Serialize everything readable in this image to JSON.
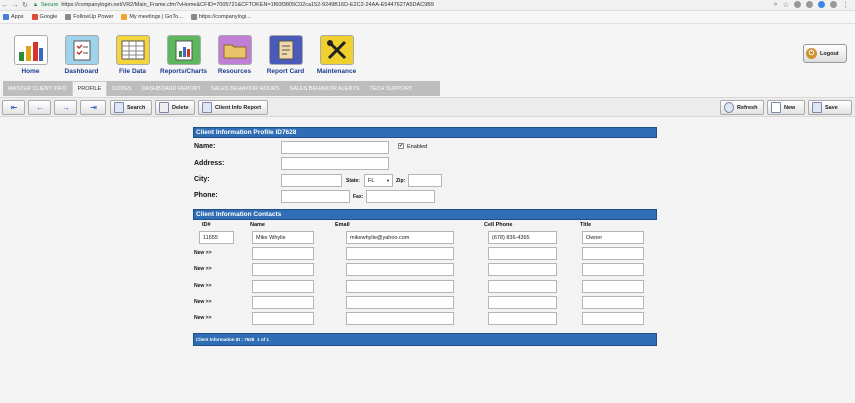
{
  "browser": {
    "secure_label": "Secure",
    "url": "https://companylogin.net/VR2/Main_Frame.cfm?vHome&CFID=7005721&CFTOKEN=1f60f3805C02ca152-9249B16D-E2C2-24AA-E5447627A5DAC9B9",
    "bookmarks": [
      "Apps",
      "Google",
      "FollowUp Power",
      "My meetings | GoTo...",
      "https://companylogi..."
    ]
  },
  "nav": {
    "items": [
      {
        "label": "Home",
        "icon": "bar-chart-icon"
      },
      {
        "label": "Dashboard",
        "icon": "checklist-icon"
      },
      {
        "label": "File Data",
        "icon": "spreadsheet-icon"
      },
      {
        "label": "Reports/Charts",
        "icon": "report-icon"
      },
      {
        "label": "Resources",
        "icon": "folder-icon"
      },
      {
        "label": "Report Card",
        "icon": "report-card-icon"
      },
      {
        "label": "Maintenance",
        "icon": "tools-icon"
      }
    ],
    "logout_label": "Logout"
  },
  "tabs": [
    "MASTER CLIENT INFO",
    "PROFILE",
    "CODES",
    "DASHBOARD REPORT",
    "SALES BEHAVIOR HOURS",
    "SALES BEHAVIOR ALERTS",
    "TECH SUPPORT"
  ],
  "active_tab": "PROFILE",
  "toolbar": {
    "search_label": "Search",
    "delete_label": "Delete",
    "client_info_report_label": "Client Info Report",
    "refresh_label": "Refresh",
    "new_label": "New",
    "save_label": "Save"
  },
  "profile": {
    "header": "Client Information Profile ID7628",
    "name_label": "Name:",
    "name_value": "",
    "enabled_label": "Enabled",
    "enabled_checked": "✔",
    "address_label": "Address:",
    "address_value": "",
    "city_label": "City:",
    "city_value": "",
    "state_label": "State:",
    "state_value": "FL",
    "zip_label": "Zip:",
    "zip_value": "",
    "phone_label": "Phone:",
    "phone_value": "",
    "fax_label": "Fax:",
    "fax_value": ""
  },
  "contacts": {
    "header": "Client Information Contacts",
    "columns": {
      "id": "ID#",
      "name": "Name",
      "email": "Email",
      "cell": "Cell Phone",
      "title": "Title"
    },
    "rows": [
      {
        "id": "11655",
        "name": "Mike Whylie",
        "email": "mikewhylie@yahoo.com",
        "cell": "(678) 836-4365",
        "title": "Owner"
      }
    ],
    "new_row_label": "New >>"
  },
  "footer": {
    "client_id": "Client Information ID : 7628",
    "pagination": "1 of 1"
  },
  "colors": {
    "section_blue": "#2f6eb4",
    "nav_label": "#1a3d8f"
  }
}
